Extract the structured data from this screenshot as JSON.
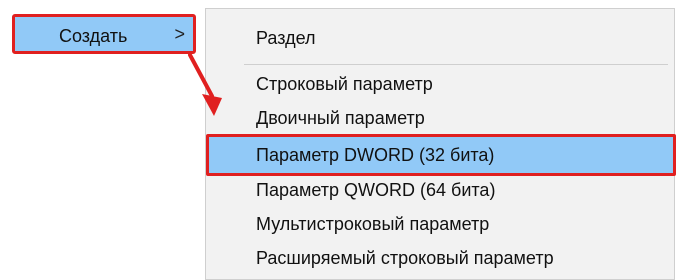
{
  "parent_menu": {
    "create_label": "Создать",
    "chevron": ">"
  },
  "submenu": {
    "items": [
      {
        "label": "Раздел"
      },
      {
        "label": "Строковый параметр"
      },
      {
        "label": "Двоичный параметр"
      },
      {
        "label": "Параметр DWORD (32 бита)"
      },
      {
        "label": "Параметр QWORD (64 бита)"
      },
      {
        "label": "Мультистроковый параметр"
      },
      {
        "label": "Расширяемый строковый параметр"
      }
    ]
  },
  "colors": {
    "highlight": "#91c9f7",
    "annotation_red": "#e02020",
    "menu_bg": "#f2f2f2"
  },
  "icons": [
    "chevron-right-icon",
    "annotation-arrow-icon"
  ]
}
